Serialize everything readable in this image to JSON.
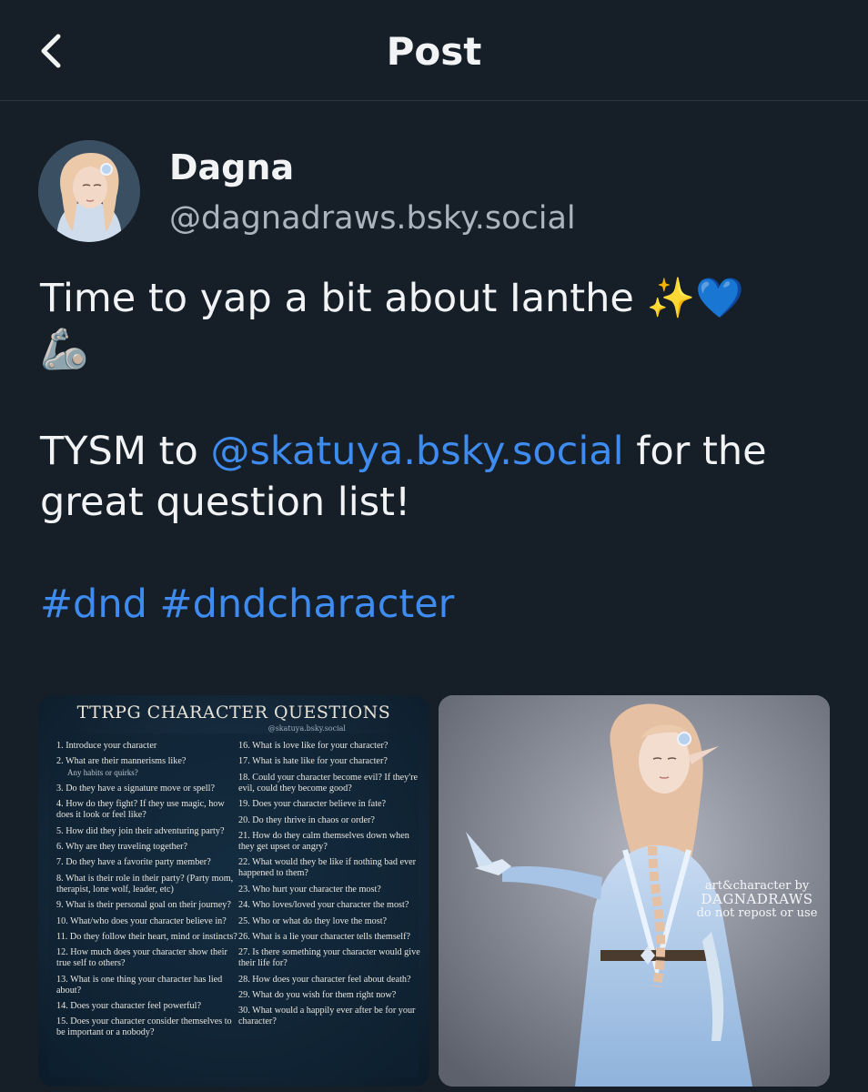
{
  "header": {
    "title": "Post",
    "back_icon": "chevron-left-icon"
  },
  "author": {
    "name": "Dagna",
    "handle": "@dagnadraws.bsky.social"
  },
  "post": {
    "line1": "Time to yap a bit about Ianthe ✨💙",
    "line2": "🦾",
    "thanks_prefix": "TYSM to ",
    "mention": "@skatuya.bsky.social",
    "thanks_suffix": " for the great question list!",
    "hashtags": [
      "#dnd",
      "#dndcharacter"
    ]
  },
  "questions_image": {
    "title": "TTRPG CHARACTER QUESTIONS",
    "credit": "@skatuya.bsky.social",
    "left": [
      {
        "t": "1. Introduce your character",
        "n": ""
      },
      {
        "t": "2. What are their mannerisms like?",
        "n": "Any habits or quirks?"
      },
      {
        "t": "3. Do they have a signature move or spell?",
        "n": ""
      },
      {
        "t": "4. How do they fight? If they use magic, how does it look or feel like?",
        "n": ""
      },
      {
        "t": "5. How did they join their adventuring party?",
        "n": ""
      },
      {
        "t": "6. Why are they traveling together?",
        "n": ""
      },
      {
        "t": "7. Do they have a favorite party member?",
        "n": ""
      },
      {
        "t": "8. What is their role in their party? (Party mom, therapist, lone wolf, leader, etc)",
        "n": ""
      },
      {
        "t": "9. What is their personal goal on their journey?",
        "n": ""
      },
      {
        "t": "10. What/who does your character believe in?",
        "n": ""
      },
      {
        "t": "11. Do they follow their heart, mind or instincts?",
        "n": ""
      },
      {
        "t": "12. How much does your character show their true self to others?",
        "n": ""
      },
      {
        "t": "13. What is one thing your character has lied about?",
        "n": ""
      },
      {
        "t": "14. Does your character feel powerful?",
        "n": ""
      },
      {
        "t": "15. Does your character consider themselves to be important or a nobody?",
        "n": ""
      }
    ],
    "right": [
      {
        "t": "16. What is love like for your character?",
        "n": ""
      },
      {
        "t": "17. What is hate like for your character?",
        "n": ""
      },
      {
        "t": "18. Could your character become evil? If they're evil, could they become good?",
        "n": ""
      },
      {
        "t": "19. Does your character believe in fate?",
        "n": ""
      },
      {
        "t": "20. Do they thrive in chaos or order?",
        "n": ""
      },
      {
        "t": "21. How do they calm themselves down when they get upset or angry?",
        "n": ""
      },
      {
        "t": "22. What would they be like if nothing bad ever happened to them?",
        "n": ""
      },
      {
        "t": "23. Who hurt your character the most?",
        "n": ""
      },
      {
        "t": "24. Who loves/loved your character the most?",
        "n": ""
      },
      {
        "t": "25. Who or what do they love the most?",
        "n": ""
      },
      {
        "t": "26. What is a lie your character tells themself?",
        "n": ""
      },
      {
        "t": "27. Is there something your character would give their life for?",
        "n": ""
      },
      {
        "t": "28. How does your character feel about death?",
        "n": ""
      },
      {
        "t": "29. What do you wish for them right now?",
        "n": ""
      },
      {
        "t": "30. What would a happily ever after be for your character?",
        "n": ""
      }
    ]
  },
  "art_image": {
    "watermark1": "art&character by",
    "watermark2": "DAGNADRAWS",
    "watermark3": "do not repost or use"
  },
  "colors": {
    "background": "#161e27",
    "link": "#3f8cf1",
    "muted": "#aab4bf"
  }
}
